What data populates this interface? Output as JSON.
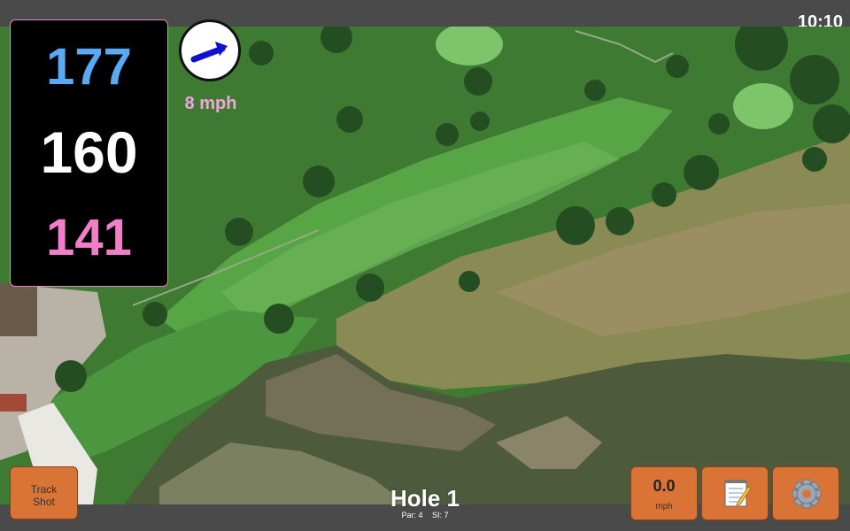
{
  "status": {
    "time": "10:10"
  },
  "yardage": {
    "back": "177",
    "middle": "160",
    "front": "141"
  },
  "wind": {
    "speed": "8 mph",
    "icon": "wind-direction-arrow-icon"
  },
  "buttons": {
    "track_shot": "Track\nShot",
    "speed_value": "0.0",
    "speed_unit": "mph",
    "notes_icon": "notepad-icon",
    "settings_icon": "gear-icon"
  },
  "hole": {
    "title": "Hole 1",
    "par": "Par: 4",
    "si": "SI: 7"
  },
  "colors": {
    "back": "#5aa9f5",
    "middle": "#ffffff",
    "front": "#f07ec9",
    "button": "#d97436",
    "wind_text": "#f6a3e1"
  }
}
